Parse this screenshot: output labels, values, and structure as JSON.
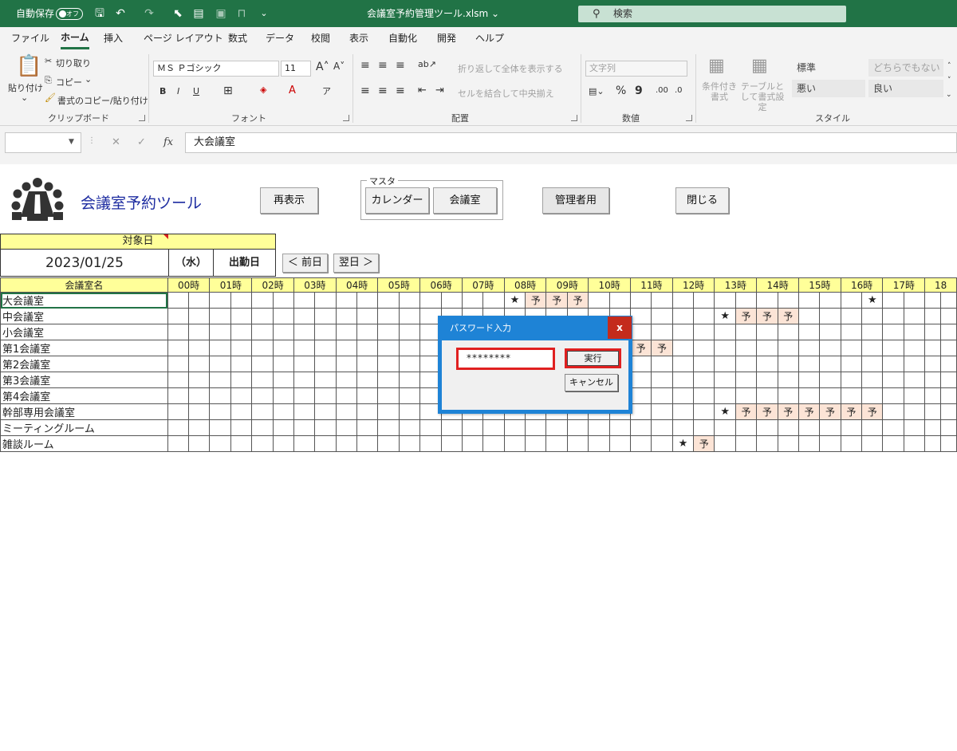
{
  "titlebar": {
    "autosave_label": "自動保存",
    "autosave_state": "オフ",
    "doc_title": "会議室予約管理ツール.xlsm ⌄",
    "search_placeholder": "検索"
  },
  "ribbon_tabs": [
    "ファイル",
    "ホーム",
    "挿入",
    "ページ レイアウト",
    "数式",
    "データ",
    "校閲",
    "表示",
    "自動化",
    "開発",
    "ヘルプ"
  ],
  "active_tab": "ホーム",
  "ribbon": {
    "clipboard": {
      "paste": "貼り付け",
      "cut": "切り取り",
      "copy": "コピー",
      "format_painter": "書式のコピー/貼り付け",
      "label": "クリップボード"
    },
    "font": {
      "font_name": "ＭＳ Ｐゴシック",
      "font_size": "11",
      "label": "フォント"
    },
    "alignment": {
      "wrap_text": "折り返して全体を表示する",
      "merge_center": "セルを結合して中央揃え",
      "label": "配置"
    },
    "number": {
      "format": "文字列",
      "label": "数値"
    },
    "styles": {
      "conditional": "条件付き書式",
      "format_table": "テーブルとして書式設定",
      "normal": "標準",
      "neutral": "どちらでもない",
      "bad": "悪い",
      "good": "良い",
      "label": "スタイル"
    }
  },
  "formula_bar": {
    "name_box": "",
    "formula": "大会議室"
  },
  "sheet": {
    "tool_title": "会議室予約ツール",
    "refresh_button": "再表示",
    "master_label": "マスタ",
    "calendar_button": "カレンダー",
    "room_button": "会議室",
    "admin_button": "管理者用",
    "close_button": "閉じる",
    "target_day_label": "対象日",
    "date": "2023/01/25",
    "weekday": "（水）",
    "day_type": "出勤日",
    "prev_button": "＜ 前日",
    "next_button": "翌日 ＞",
    "room_header": "会議室名",
    "hours": [
      "00時",
      "01時",
      "02時",
      "03時",
      "04時",
      "05時",
      "06時",
      "07時",
      "08時",
      "09時",
      "10時",
      "11時",
      "12時",
      "13時",
      "14時",
      "15時",
      "16時",
      "17時",
      "18"
    ],
    "rooms": [
      {
        "name": "大会議室",
        "marks": {
          "16": "★",
          "17": "予",
          "18": "予",
          "19": "予",
          "33": "★"
        }
      },
      {
        "name": "中会議室",
        "marks": {
          "26": "★",
          "27": "予",
          "28": "予",
          "29": "予"
        }
      },
      {
        "name": "小会議室",
        "marks": {}
      },
      {
        "name": "第1会議室",
        "marks": {
          "22": "予",
          "23": "予"
        }
      },
      {
        "name": "第2会議室",
        "marks": {}
      },
      {
        "name": "第3会議室",
        "marks": {}
      },
      {
        "name": "第4会議室",
        "marks": {}
      },
      {
        "name": "幹部専用会議室",
        "marks": {
          "26": "★",
          "27": "予",
          "28": "予",
          "29": "予",
          "30": "予",
          "31": "予",
          "32": "予",
          "33": "予"
        }
      },
      {
        "name": "ミーティングルーム",
        "marks": {}
      },
      {
        "name": "雑談ルーム",
        "marks": {
          "24": "★",
          "25": "予"
        }
      }
    ]
  },
  "dialog": {
    "title": "パスワード入力",
    "close": "x",
    "password": "********",
    "exec_button": "実行",
    "cancel_button": "キャンセル"
  },
  "colors": {
    "excel_green": "#217346",
    "header_yellow": "#ffff99",
    "reservation_fill": "#fce4d6",
    "dialog_blue": "#1e83d6",
    "highlight_red": "#e02020",
    "title_navy": "#1c2ba0"
  }
}
